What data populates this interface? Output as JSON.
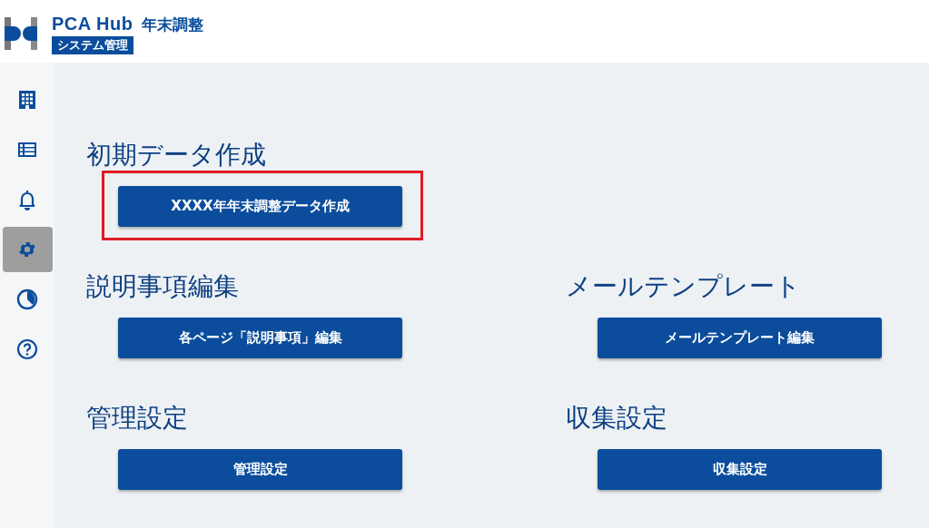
{
  "header": {
    "brand": "PCA Hub",
    "product": "年末調整",
    "subtitle": "システム管理"
  },
  "sidebar": {
    "items": [
      {
        "kind": "building",
        "selected": false
      },
      {
        "kind": "list",
        "selected": false
      },
      {
        "kind": "bell",
        "selected": false
      },
      {
        "kind": "gear",
        "selected": true
      },
      {
        "kind": "clock",
        "selected": false
      },
      {
        "kind": "help",
        "selected": false
      }
    ]
  },
  "rows": [
    {
      "sections": [
        {
          "title": "初期データ作成",
          "button": {
            "label": "XXXX年年末調整データ作成",
            "highlighted": true
          }
        }
      ]
    },
    {
      "sections": [
        {
          "title": "説明事項編集",
          "button": {
            "label": "各ページ「説明事項」編集",
            "highlighted": false
          }
        },
        {
          "title": "メールテンプレート",
          "button": {
            "label": "メールテンプレート編集",
            "highlighted": false
          }
        }
      ]
    },
    {
      "sections": [
        {
          "title": "管理設定",
          "button": {
            "label": "管理設定",
            "highlighted": false
          }
        },
        {
          "title": "収集設定",
          "button": {
            "label": "収集設定",
            "highlighted": false
          }
        }
      ]
    }
  ]
}
